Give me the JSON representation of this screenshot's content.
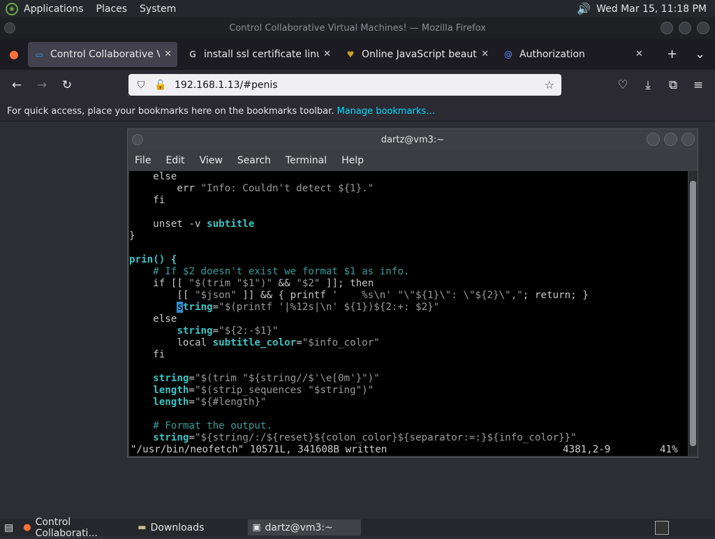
{
  "top_panel": {
    "menus": [
      "Applications",
      "Places",
      "System"
    ],
    "clock": "Wed Mar 15, 11:18 PM"
  },
  "firefox": {
    "window_title": "Control Collaborative Virtual Machines! — Mozilla Firefox",
    "tabs": [
      {
        "label": "Control Collaborative Virtual Machines!",
        "icon": "monitor-icon",
        "active": true
      },
      {
        "label": "install ssl certificate linux - Google",
        "icon": "google-icon",
        "active": false
      },
      {
        "label": "Online JavaScript beautifier",
        "icon": "beautifier-icon",
        "active": false
      },
      {
        "label": "Authorization",
        "icon": "at-icon",
        "active": false
      }
    ],
    "url": "192.168.1.13/#penis",
    "bookmarks_text": "For quick access, place your bookmarks here on the bookmarks toolbar.",
    "bookmarks_link": "Manage bookmarks…"
  },
  "terminal": {
    "title": "dartz@vm3:~",
    "menu": [
      "File",
      "Edit",
      "View",
      "Search",
      "Terminal",
      "Help"
    ],
    "status_msg": "\"/usr/bin/neofetch\" 10571L, 341608B written",
    "status_pos": "4381,2-9",
    "status_pct": "41%"
  },
  "taskbar": {
    "items": [
      {
        "label": "Control Collaborati...",
        "icon": "firefox-icon"
      },
      {
        "label": "Downloads",
        "icon": "folder-icon"
      },
      {
        "label": "dartz@vm3:~",
        "icon": "terminal-icon"
      }
    ]
  }
}
